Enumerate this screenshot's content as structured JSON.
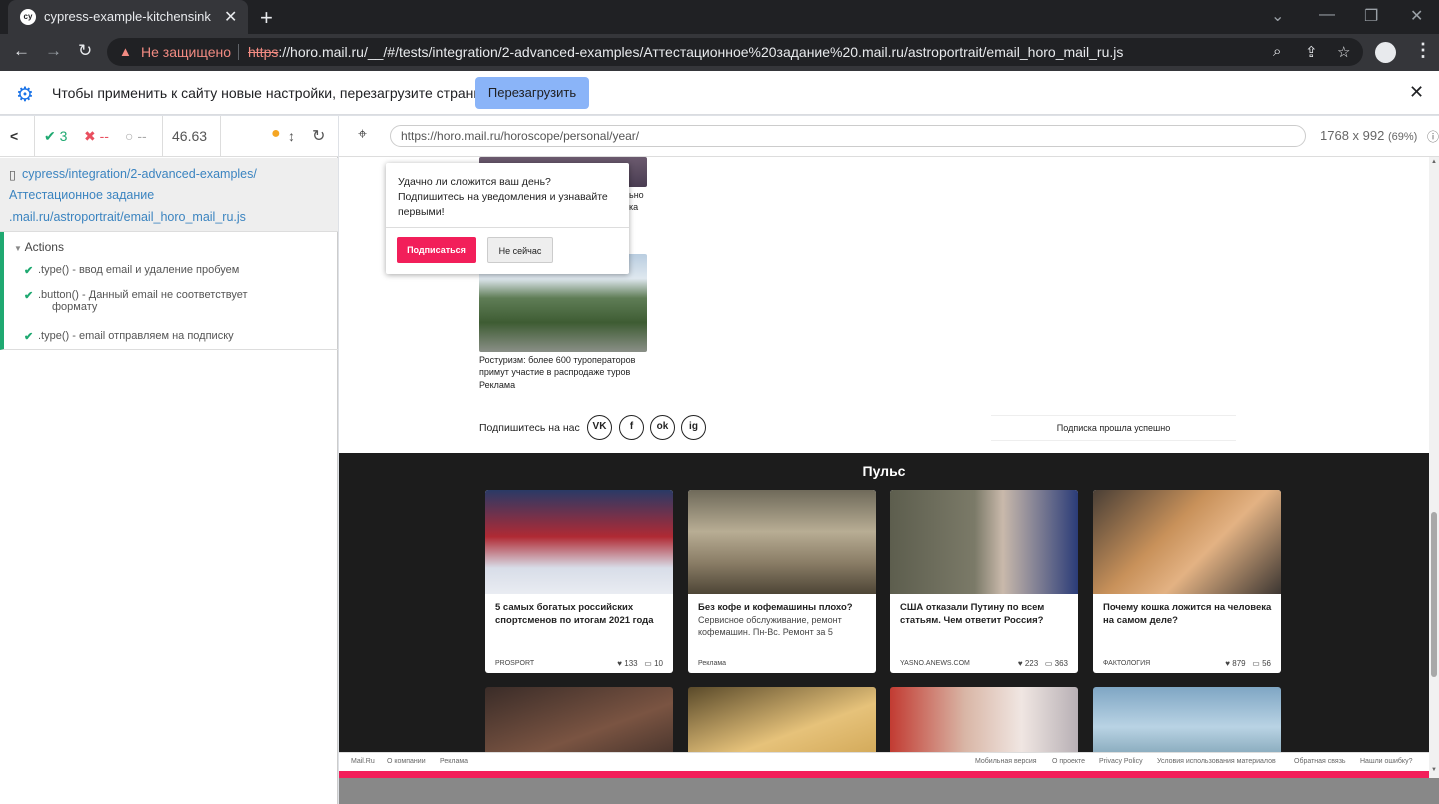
{
  "browser": {
    "tab_title": "cypress-example-kitchensink",
    "favicon": "cy",
    "new_tab_symbol": "+",
    "security_label": "Не защищено",
    "url_scheme": "https",
    "url_rest": "://horo.mail.ru/__/#/tests/integration/2-advanced-examples/Аттестационное%20задание%20.mail.ru/astroportrait/email_horo_mail_ru.js"
  },
  "infobar": {
    "message": "Чтобы применить к сайту новые настройки, перезагрузите страницу",
    "reload_label": "Перезагрузить"
  },
  "reporter": {
    "passed": "3",
    "failed": "--",
    "pending": "--",
    "duration": "46.63",
    "spec_path_1": "cypress/integration/2-advanced-examples/",
    "spec_path_2": "Аттестационное задание",
    "spec_path_3": ".mail.ru/astroportrait/email_horo_mail_ru.js",
    "actions_title": "Actions",
    "actions": [
      {
        "line1": ".type() - ввод email и удаление пробуем",
        "line2": ""
      },
      {
        "line1": ".button() - Данный email не соответствует",
        "line2": "формату"
      },
      {
        "line1": ".type() - email отправляем на подписку",
        "line2": ""
      }
    ]
  },
  "aut": {
    "url": "https://horo.mail.ru/horoscope/personal/year/",
    "size": "1768 x 992",
    "scale": "(69%)"
  },
  "page": {
    "popup_text": "Удачно ли сложится ваш день? Подпишитесь на уведомления и узнавайте первыми!",
    "popup_subscribe": "Подписаться",
    "popup_not_now": "Не сейчас",
    "partial_ad_1": "ьно",
    "partial_ad_2": "ка",
    "ad_title": "Ростуризм: более 600 туроператоров примут участие в распродаже туров",
    "ad_label": "Реклама",
    "follow_label": "Подпишитесь на нас",
    "social": [
      "VK",
      "f",
      "ok",
      "ig"
    ],
    "subscription_status": "Подписка прошла успешно",
    "pulse_title": "Пульс",
    "cards": [
      {
        "title": "5 самых богатых российских спортсменов по итогам 2021 года",
        "desc": "",
        "source": "PROSPORT",
        "likes": "133",
        "comments": "10"
      },
      {
        "title": "Без кофе и кофемашины плохо?",
        "desc": "Сервисное обслуживание, ремонт кофемашин. Пн-Вс. Ремонт за 5",
        "source": "Реклама",
        "likes": "",
        "comments": ""
      },
      {
        "title": "США отказали Путину по всем статьям. Чем ответит Россия?",
        "desc": "",
        "source": "YASNO.ANEWS.COM",
        "likes": "223",
        "comments": "363"
      },
      {
        "title": "Почему кошка ложится на человека на самом деле?",
        "desc": "",
        "source": "ФАКТОЛОГИЯ",
        "likes": "879",
        "comments": "56"
      }
    ],
    "footer_left": [
      "Mail.Ru",
      "О компании",
      "Реклама"
    ],
    "footer_right": [
      "Мобильная версия",
      "О проекте",
      "Privacy Policy",
      "Условия использования материалов",
      "Обратная связь",
      "Нашли ошибку?"
    ]
  }
}
